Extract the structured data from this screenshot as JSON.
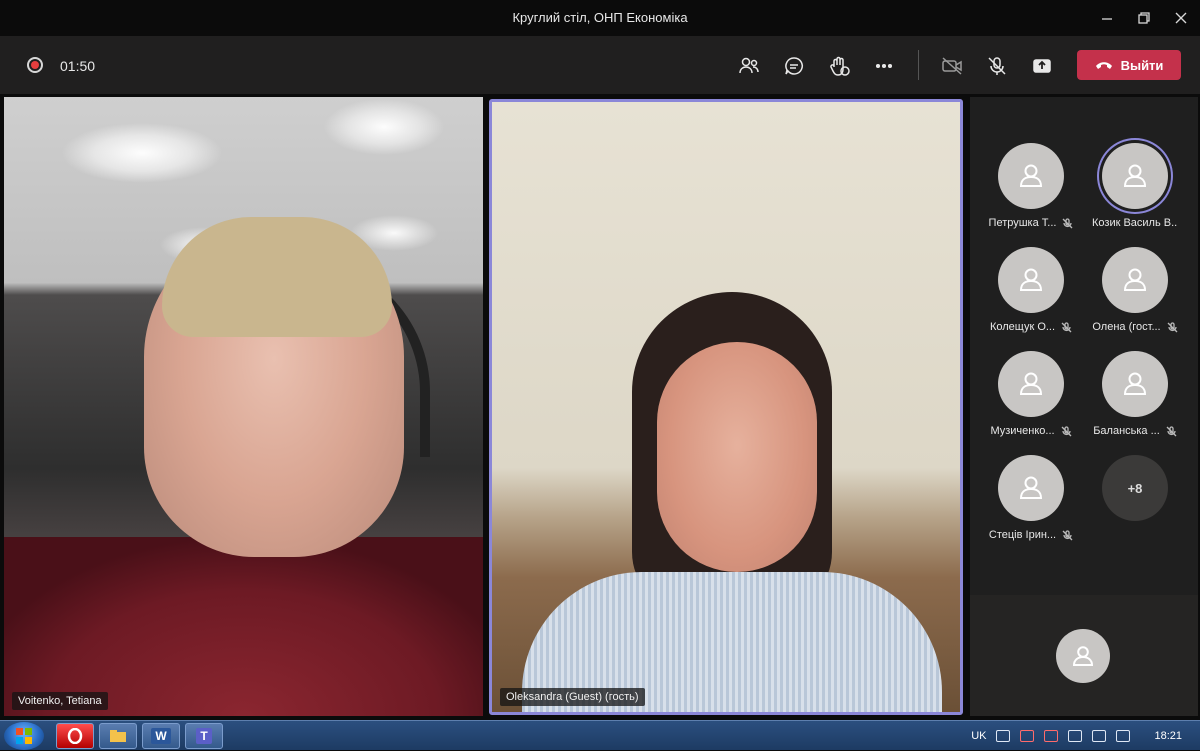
{
  "window": {
    "title": "Круглий стіл, ОНП Економіка"
  },
  "toolbar": {
    "timer": "01:50",
    "leave_label": "Выйти",
    "leave_color": "#c4314b"
  },
  "videos": [
    {
      "name": "Voitenko, Tetiana"
    },
    {
      "name": "Oleksandra (Guest) (гость)"
    }
  ],
  "participants": [
    {
      "name": "Петрушка Т...",
      "muted": true,
      "active": false
    },
    {
      "name": "Козик Василь В...",
      "muted": false,
      "active": true
    },
    {
      "name": "Колещук О...",
      "muted": true,
      "active": false
    },
    {
      "name": "Олена (гост...",
      "muted": true,
      "active": false
    },
    {
      "name": "Музиченко...",
      "muted": true,
      "active": false
    },
    {
      "name": "Баланська ...",
      "muted": true,
      "active": false
    },
    {
      "name": "Стецiв Iрин...",
      "muted": true,
      "active": false
    }
  ],
  "more_participants": "+8",
  "taskbar": {
    "language": "UK",
    "time": "18:21",
    "apps": [
      "opera-icon",
      "file-explorer-icon",
      "word-icon",
      "teams-icon"
    ],
    "word_label": "W",
    "teams_label": "T"
  },
  "accent_color": "#8b87d8"
}
